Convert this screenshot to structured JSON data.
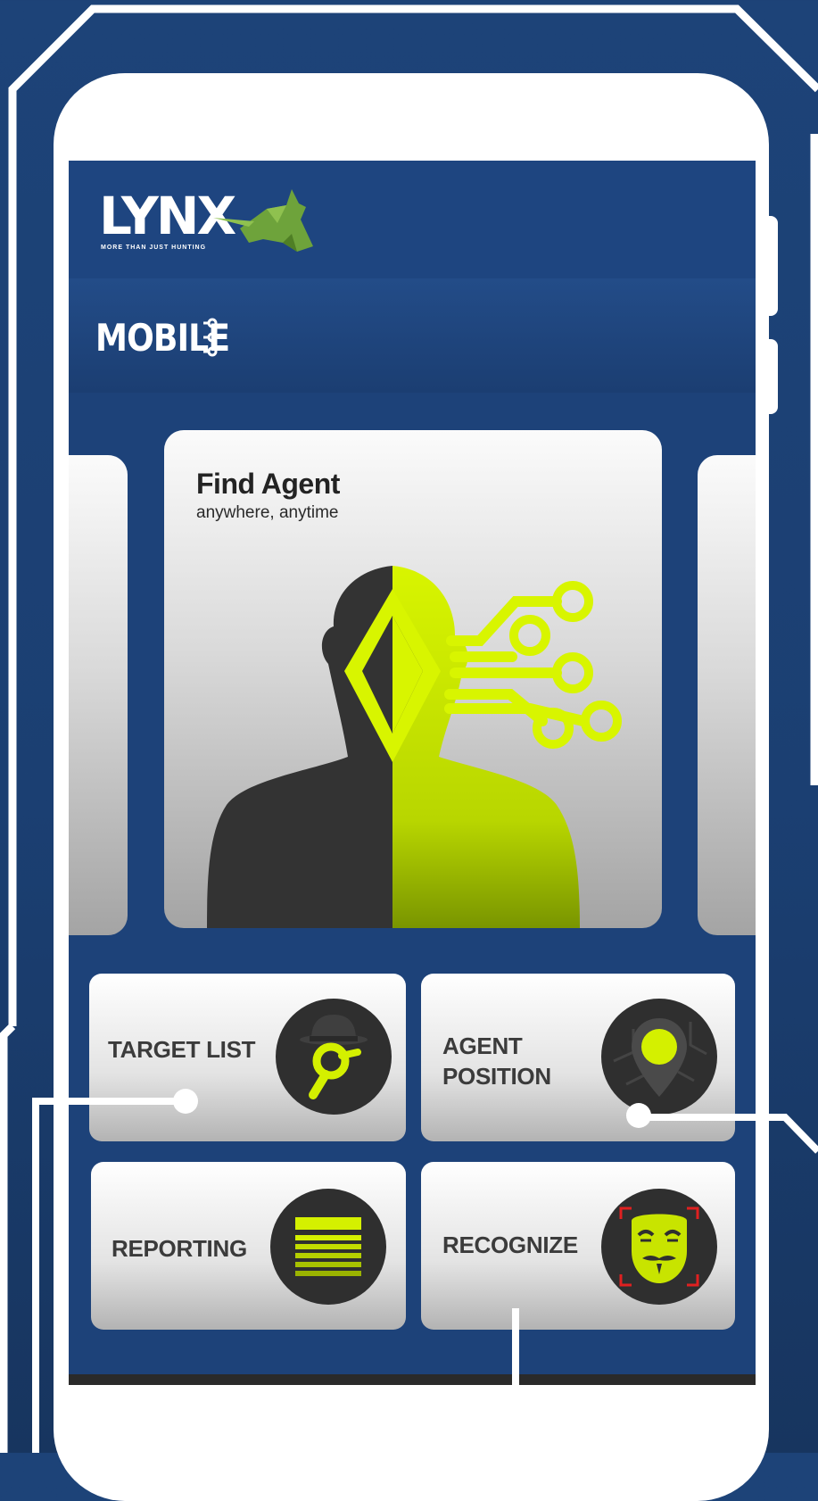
{
  "header": {
    "logo_text": "LYNX",
    "logo_tagline": "MORE THAN JUST HUNTING"
  },
  "subheader": {
    "title": "MOBILE"
  },
  "hero_card": {
    "title": "Find Agent",
    "subtitle": "anywhere, anytime"
  },
  "tiles": [
    {
      "label_line1": "TARGET LIST",
      "label_line2": "",
      "icon": "spy-search-icon"
    },
    {
      "label_line1": "AGENT",
      "label_line2": "POSITION",
      "icon": "map-pin-icon"
    },
    {
      "label_line1": "REPORTING",
      "label_line2": "",
      "icon": "report-list-icon"
    },
    {
      "label_line1": "RECOGNIZE",
      "label_line2": "",
      "icon": "mask-face-icon"
    }
  ],
  "colors": {
    "background": "#1d4279",
    "accent": "#d4f000",
    "icon_dark": "#2f2f2f",
    "face_frame": "#e02020"
  }
}
